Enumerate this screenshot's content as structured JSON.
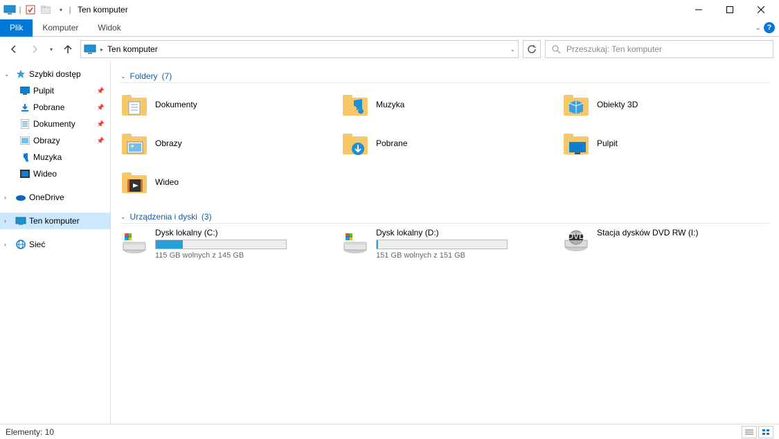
{
  "title": "Ten komputer",
  "tabs": {
    "file": "Plik",
    "computer": "Komputer",
    "view": "Widok"
  },
  "address": {
    "text": "Ten komputer"
  },
  "search": {
    "placeholder": "Przeszukaj: Ten komputer"
  },
  "sidebar": {
    "quick": "Szybki dostęp",
    "items": [
      {
        "label": "Pulpit"
      },
      {
        "label": "Pobrane"
      },
      {
        "label": "Dokumenty"
      },
      {
        "label": "Obrazy"
      },
      {
        "label": "Muzyka"
      },
      {
        "label": "Wideo"
      }
    ],
    "onedrive": "OneDrive",
    "thispc": "Ten komputer",
    "network": "Sieć"
  },
  "groups": {
    "folders": {
      "title": "Foldery",
      "count": "(7)"
    },
    "drives": {
      "title": "Urządzenia i dyski",
      "count": "(3)"
    }
  },
  "folders": [
    {
      "label": "Dokumenty",
      "icon": "documents"
    },
    {
      "label": "Muzyka",
      "icon": "music"
    },
    {
      "label": "Obiekty 3D",
      "icon": "3d"
    },
    {
      "label": "Obrazy",
      "icon": "pictures"
    },
    {
      "label": "Pobrane",
      "icon": "downloads"
    },
    {
      "label": "Pulpit",
      "icon": "desktop"
    },
    {
      "label": "Wideo",
      "icon": "videos"
    }
  ],
  "drives": [
    {
      "label": "Dysk lokalny (C:)",
      "sub": "115 GB wolnych z 145 GB",
      "fill": 21,
      "type": "hdd"
    },
    {
      "label": "Dysk lokalny (D:)",
      "sub": "151 GB wolnych z 151 GB",
      "fill": 1,
      "type": "hdd"
    },
    {
      "label": "Stacja dysków DVD RW (I:)",
      "sub": "",
      "fill": null,
      "type": "dvd"
    }
  ],
  "status": {
    "items": "Elementy: 10"
  }
}
